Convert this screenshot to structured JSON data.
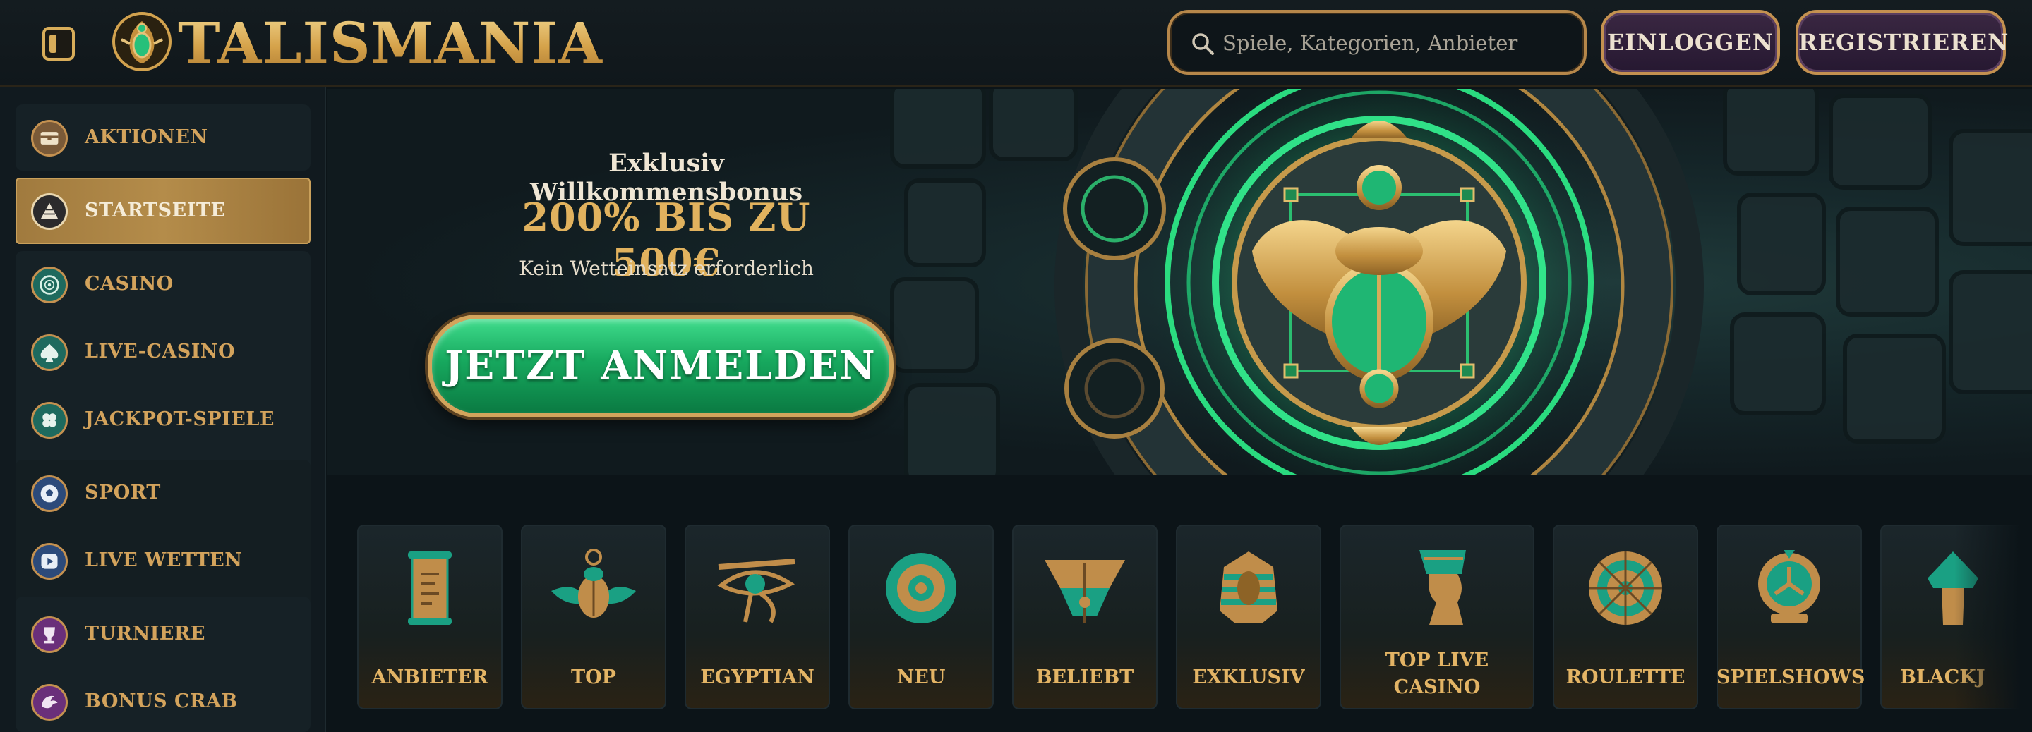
{
  "brand": {
    "name": "TALISMANIA"
  },
  "header": {
    "search_placeholder": "Spiele, Kategorien, Anbieter",
    "login_label": "EINLOGGEN",
    "register_label": "REGISTRIEREN"
  },
  "sidebar": {
    "items": [
      {
        "label": "AKTIONEN",
        "icon": "treasure-chest-icon"
      },
      {
        "label": "STARTSEITE",
        "icon": "pyramid-icon",
        "active": true
      },
      {
        "label": "CASINO",
        "icon": "casino-chip-icon"
      },
      {
        "label": "LIVE-CASINO",
        "icon": "spade-icon"
      },
      {
        "label": "JACKPOT-SPIELE",
        "icon": "clover-icon"
      },
      {
        "label": "SPORT",
        "icon": "soccer-ball-icon"
      },
      {
        "label": "LIVE WETTEN",
        "icon": "play-icon"
      },
      {
        "label": "TURNIERE",
        "icon": "trophy-icon"
      },
      {
        "label": "BONUS CRAB",
        "icon": "crab-claw-icon"
      }
    ]
  },
  "hero": {
    "kicker": "Exklusiv Willkommensbonus",
    "offer": "200% BIS ZU 500€",
    "note": "Kein Wetteinsatz erforderlich",
    "cta": "JETZT ANMELDEN"
  },
  "categories": [
    {
      "label": "ANBIETER",
      "icon": "papyrus-scroll-icon"
    },
    {
      "label": "TOP",
      "icon": "scarab-icon"
    },
    {
      "label": "EGYPTIAN",
      "icon": "eye-of-horus-icon"
    },
    {
      "label": "NEU",
      "icon": "sun-disc-icon"
    },
    {
      "label": "BELIEBT",
      "icon": "winged-emblem-icon"
    },
    {
      "label": "EXKLUSIV",
      "icon": "pharaoh-icon"
    },
    {
      "label": "TOP LIVE CASINO",
      "icon": "nefertiti-icon"
    },
    {
      "label": "ROULETTE",
      "icon": "roulette-wheel-icon"
    },
    {
      "label": "SPIELSHOWS",
      "icon": "wheel-show-icon"
    },
    {
      "label": "BLACKJ",
      "icon": "blackjack-icon"
    }
  ],
  "colors": {
    "gold": "#d3a35c",
    "green_cta": "#17a85e",
    "purple_button": "#2e1f3a",
    "background": "#0c1418"
  }
}
